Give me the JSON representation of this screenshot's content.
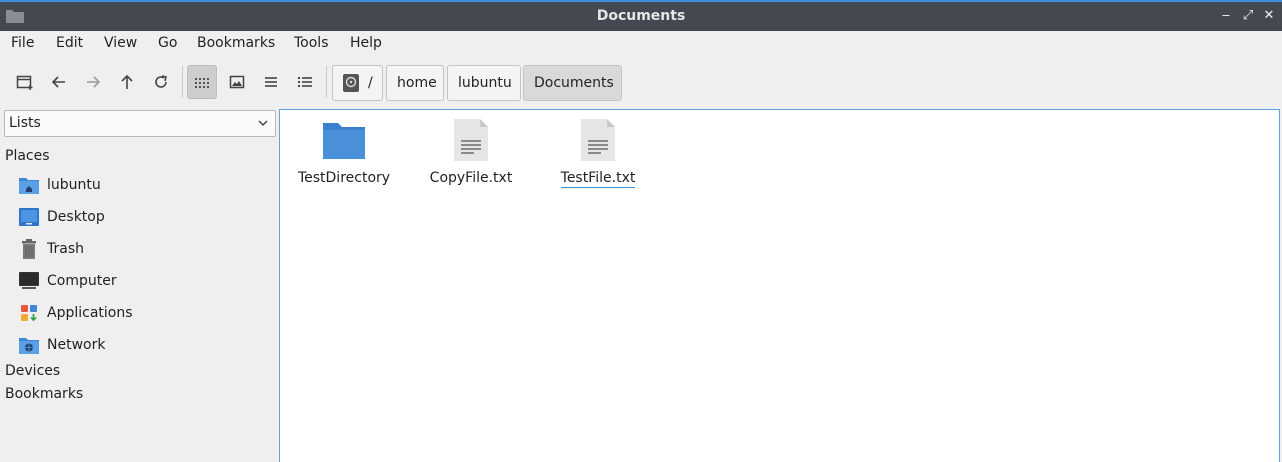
{
  "window": {
    "title": "Documents",
    "controls": {
      "minimize": "‒",
      "maximize": "⤢",
      "close": "✕"
    }
  },
  "menubar": {
    "items": [
      "File",
      "Edit",
      "View",
      "Go",
      "Bookmarks",
      "Tools",
      "Help"
    ]
  },
  "toolbar": {
    "buttons": [
      "new-tab-icon",
      "back-arrow-icon",
      "forward-arrow-icon",
      "up-arrow-icon",
      "reload-icon",
      "icon-view-icon",
      "thumbnail-view-icon",
      "compact-view-icon",
      "detailed-list-icon"
    ],
    "active_view": "icon-view-icon",
    "breadcrumb": [
      "/",
      "home",
      "lubuntu",
      "Documents"
    ]
  },
  "sidebar": {
    "mode": "Lists",
    "places_header": "Places",
    "places": [
      {
        "label": "lubuntu",
        "icon": "home-folder-icon"
      },
      {
        "label": "Desktop",
        "icon": "desktop-icon"
      },
      {
        "label": "Trash",
        "icon": "trash-icon"
      },
      {
        "label": "Computer",
        "icon": "computer-icon"
      },
      {
        "label": "Applications",
        "icon": "applications-icon"
      },
      {
        "label": "Network",
        "icon": "network-folder-icon"
      }
    ],
    "devices_header": "Devices",
    "bookmarks_header": "Bookmarks"
  },
  "files": [
    {
      "name": "TestDirectory",
      "type": "folder"
    },
    {
      "name": "CopyFile.txt",
      "type": "text"
    },
    {
      "name": "TestFile.txt",
      "type": "text",
      "focused": true
    }
  ],
  "colors": {
    "accent": "#3a8fd8",
    "titlebar": "#444850",
    "folder": "#4a90d9"
  }
}
